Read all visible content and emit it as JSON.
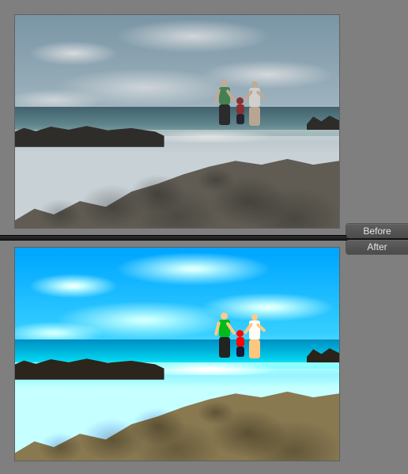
{
  "labels": {
    "before": "Before",
    "after": "After"
  }
}
